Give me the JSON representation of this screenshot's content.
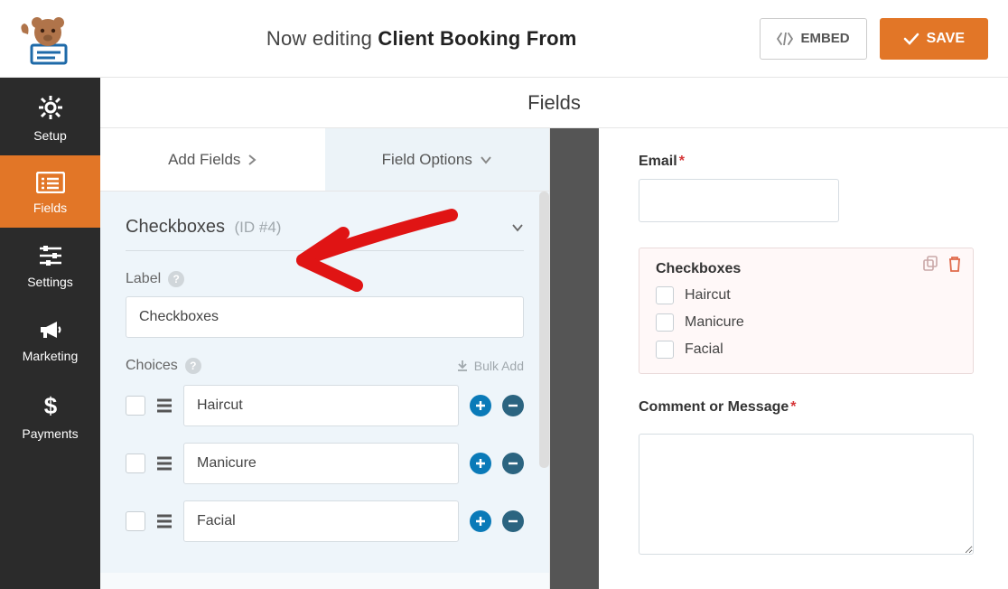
{
  "header": {
    "title_prefix": "Now editing",
    "title_bold": "Client Booking From",
    "embed_label": "EMBED",
    "save_label": "SAVE"
  },
  "sidebar": {
    "items": [
      {
        "label": "Setup",
        "icon": "gear"
      },
      {
        "label": "Fields",
        "icon": "list",
        "active": true
      },
      {
        "label": "Settings",
        "icon": "sliders"
      },
      {
        "label": "Marketing",
        "icon": "bullhorn"
      },
      {
        "label": "Payments",
        "icon": "dollar"
      }
    ]
  },
  "center": {
    "page_tab_label": "Fields",
    "tabs": {
      "add_fields": "Add Fields",
      "field_options": "Field Options"
    },
    "field_name": "Checkboxes",
    "field_id_tag": "(ID #4)",
    "label_label": "Label",
    "label_value": "Checkboxes",
    "choices_label": "Choices",
    "bulk_add": "Bulk Add",
    "choices": [
      {
        "value": "Haircut"
      },
      {
        "value": "Manicure"
      },
      {
        "value": "Facial"
      }
    ]
  },
  "preview": {
    "email_label": "Email",
    "checkbox_heading": "Checkboxes",
    "checkbox_items": [
      "Haircut",
      "Manicure",
      "Facial"
    ],
    "comment_label": "Comment or Message"
  }
}
